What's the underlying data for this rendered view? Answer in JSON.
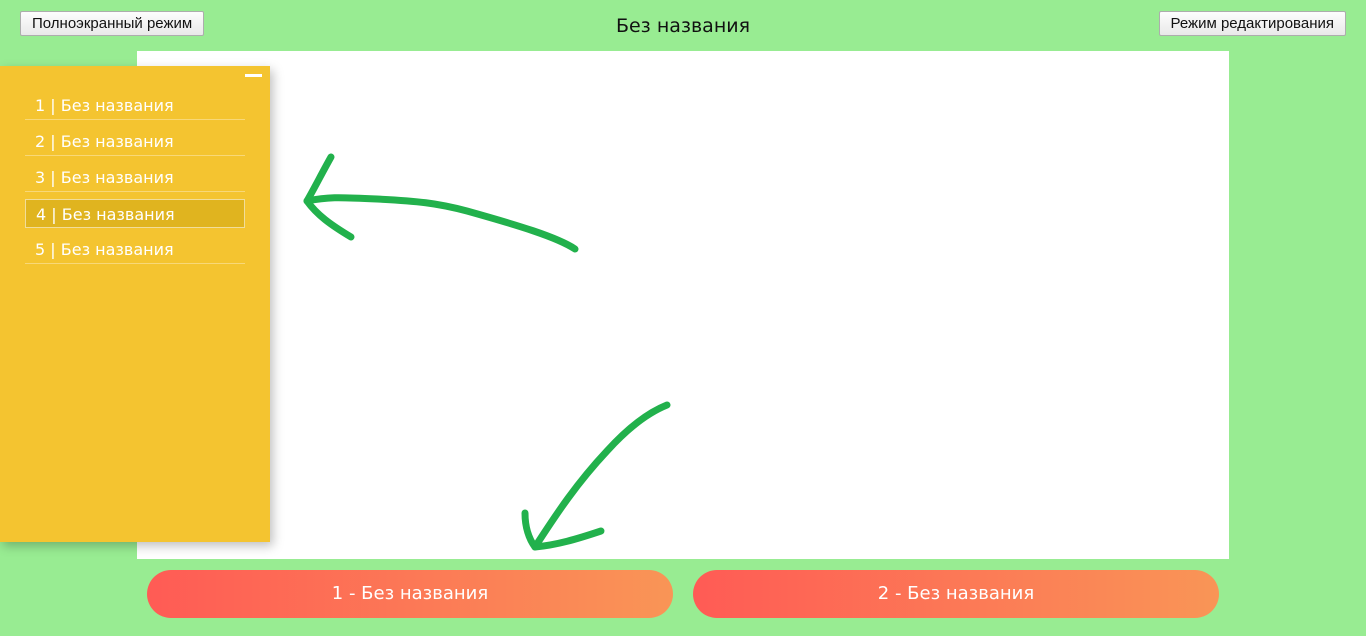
{
  "header": {
    "fullscreen_label": "Полноэкранный режим",
    "title": "Без названия",
    "edit_label": "Режим редактирования"
  },
  "sidebar": {
    "items": [
      {
        "label": "1 | Без названия",
        "active": false
      },
      {
        "label": "2 | Без названия",
        "active": false
      },
      {
        "label": "3 | Без названия",
        "active": false
      },
      {
        "label": "4 | Без названия",
        "active": true
      },
      {
        "label": "5 | Без названия",
        "active": false
      }
    ]
  },
  "nav": {
    "buttons": [
      {
        "label": "1 - Без названия"
      },
      {
        "label": "2 - Без названия"
      }
    ]
  },
  "colors": {
    "background": "#98ec92",
    "sidebar": "#f4c430",
    "sidebar_active": "#e0b41f",
    "nav_gradient_start": "#ff5b55",
    "nav_gradient_end": "#f99556",
    "drawing_stroke": "#22b14c"
  }
}
